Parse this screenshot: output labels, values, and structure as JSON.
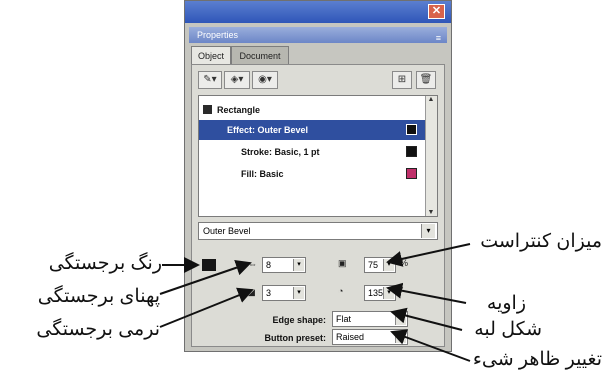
{
  "window": {
    "close_glyph": "✕",
    "panel_title": "Properties",
    "panel_grip": "≡"
  },
  "tabs": [
    {
      "label": "Object"
    },
    {
      "label": "Document"
    }
  ],
  "toolbar": {
    "stroke_tool": "✎▾",
    "fill_tool": "◈▾",
    "effect_tool": "◉▾",
    "add_btn": "⊞",
    "delete_btn": "🗑"
  },
  "object_list": [
    {
      "label": "Rectangle"
    },
    {
      "label": "Effect: Outer Bevel",
      "swatch": "#111111"
    },
    {
      "label": "Stroke: Basic, 1 pt",
      "swatch": "#111111"
    },
    {
      "label": "Fill: Basic",
      "swatch": "#c0306a"
    }
  ],
  "effect_select": {
    "value": "Outer Bevel",
    "arrow": "▾"
  },
  "controls": {
    "width_value": "8",
    "contrast_value": "75",
    "contrast_unit": "%",
    "softness_value": "3",
    "angle_value": "135",
    "angle_unit": "°",
    "edge_shape_label": "Edge shape:",
    "edge_shape_value": "Flat",
    "button_preset_label": "Button preset:",
    "button_preset_value": "Raised",
    "spinner": "▾"
  },
  "annotations": {
    "bevel_color": "رنگ برجستگی",
    "bevel_width": "پهنای برجستگی",
    "bevel_softness": "نرمی برجستگی",
    "contrast": "میزان کنتراست",
    "angle": "زاویه",
    "edge_shape": "شکل لبه",
    "appearance": "تغییر ظاهر شیء"
  },
  "colors": {
    "accent": "#2f4f9f",
    "title_bar": "#3d62bf",
    "close_button": "#d9634b",
    "panel_bg": "#c6c6c0"
  }
}
